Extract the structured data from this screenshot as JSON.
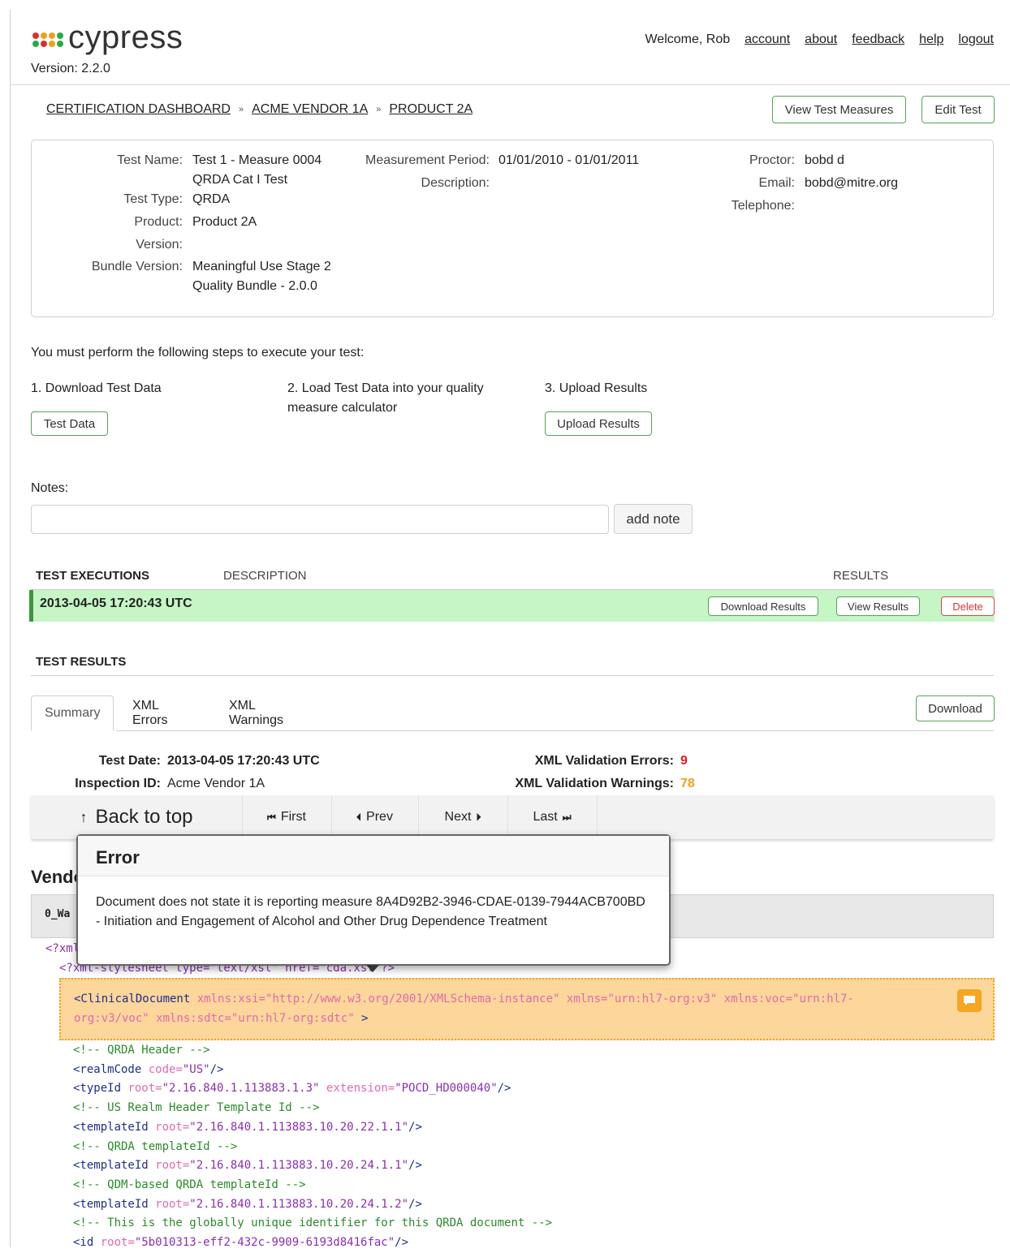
{
  "app": {
    "name": "cypress",
    "version": "Version: 2.2.0",
    "logo_colors": [
      "#d9312b",
      "#e8a31d",
      "#e8a31d",
      "#2ba84a",
      "#2ba84a",
      "#d9312b",
      "#e8a31d",
      "#2ba84a"
    ]
  },
  "topnav": {
    "welcome": "Welcome, Rob",
    "links": [
      "account",
      "about",
      "feedback",
      "help",
      "logout"
    ]
  },
  "breadcrumb": {
    "items": [
      "CERTIFICATION DASHBOARD",
      "ACME VENDOR 1A",
      "PRODUCT 2A"
    ],
    "separator": "»"
  },
  "actions": {
    "view_test_measures": "View Test Measures",
    "edit_test": "Edit Test"
  },
  "test_info": {
    "test_name_label": "Test Name:",
    "test_name": "Test 1 - Measure 0004\nQRDA Cat I Test",
    "test_type_label": "Test Type:",
    "test_type": "QRDA",
    "product_label": "Product:",
    "product": "Product 2A",
    "version_label": "Version:",
    "version": "",
    "bundle_version_label": "Bundle Version:",
    "bundle_version": "Meaningful Use Stage 2\nQuality Bundle - 2.0.0",
    "measurement_period_label": "Measurement Period:",
    "measurement_period": "01/01/2010 - 01/01/2011",
    "description_label": "Description:",
    "description": "",
    "proctor_label": "Proctor:",
    "proctor": "bobd d",
    "email_label": "Email:",
    "email": "bobd@mitre.org",
    "telephone_label": "Telephone:",
    "telephone": ""
  },
  "steps": {
    "intro": "You must perform the following steps to execute your test:",
    "step1": "1. Download Test Data",
    "step1_button": "Test Data",
    "step2": "2. Load Test Data into your quality measure calculator",
    "step3": "3. Upload Results",
    "step3_button": "Upload Results"
  },
  "notes": {
    "label": "Notes:",
    "value": "",
    "add_button": "add note"
  },
  "executions": {
    "col_executions": "TEST EXECUTIONS",
    "col_description": "DESCRIPTION",
    "col_results": "RESULTS",
    "rows": [
      {
        "date": "2013-04-05 17:20:43 UTC",
        "download": "Download Results",
        "view": "View Results",
        "delete": "Delete"
      }
    ]
  },
  "results": {
    "heading": "TEST RESULTS",
    "tabs": [
      "Summary",
      "XML Errors",
      "XML Warnings"
    ],
    "download": "Download",
    "test_date_label": "Test Date:",
    "test_date": "2013-04-05 17:20:43 UTC",
    "inspection_id_label": "Inspection ID:",
    "inspection_id": "Acme Vendor 1A",
    "errors_label": "XML Validation Errors:",
    "errors": "9",
    "warnings_label": "XML Validation Warnings:",
    "warnings": "78",
    "errors_color": "#e02020",
    "warnings_color": "#f0a020"
  },
  "nav_toolbar": {
    "back_to_top": "Back to top",
    "first": "First",
    "prev": "Prev",
    "next": "Next",
    "last": "Last"
  },
  "vendor": {
    "title": "Vendor",
    "file_name": "0_Wa"
  },
  "popover": {
    "title": "Error",
    "message": "Document does not state it is reporting measure 8A4D92B2-3946-CDAE-0139-7944ACB700BD - Initiation and Engagement of Alcohol and Other Drug Dependence Treatment"
  },
  "code": {
    "line_xml": "<?xml",
    "line_stylesheet": "<?xml-stylesheet type=\"text/xsl\" href=\"cda.xsl\"?>",
    "clinical_tag": "<ClinicalDocument",
    "clinical_attrs_1": " xmlns:xsi=\"http://www.w3.org/2001/XMLSchema-instance\" xmlns=\"urn:hl7-org:v3\" xmlns:voc=\"urn:hl7-",
    "clinical_attrs_2": "org:v3/voc\" xmlns:sdtc=\"urn:hl7-org:sdtc\"",
    "clinical_close": " >",
    "lines": [
      {
        "type": "comment",
        "text": "<!-- QRDA Header -->"
      },
      {
        "type": "element",
        "tag": "<realmCode",
        "attrs": [
          [
            "code",
            "\"US\""
          ]
        ],
        "close": "/>"
      },
      {
        "type": "element",
        "tag": "<typeId",
        "attrs": [
          [
            "root",
            "\"2.16.840.1.113883.1.3\""
          ],
          [
            "extension",
            "\"POCD_HD000040\""
          ]
        ],
        "close": "/>"
      },
      {
        "type": "comment",
        "text": "<!-- US Realm Header Template Id -->"
      },
      {
        "type": "element",
        "tag": "<templateId",
        "attrs": [
          [
            "root",
            "\"2.16.840.1.113883.10.20.22.1.1\""
          ]
        ],
        "close": "/>"
      },
      {
        "type": "comment",
        "text": "<!-- QRDA templateId -->"
      },
      {
        "type": "element",
        "tag": "<templateId",
        "attrs": [
          [
            "root",
            "\"2.16.840.1.113883.10.20.24.1.1\""
          ]
        ],
        "close": "/>"
      },
      {
        "type": "comment",
        "text": "<!-- QDM-based QRDA templateId -->"
      },
      {
        "type": "element",
        "tag": "<templateId",
        "attrs": [
          [
            "root",
            "\"2.16.840.1.113883.10.20.24.1.2\""
          ]
        ],
        "close": "/>"
      },
      {
        "type": "comment",
        "text": "<!-- This is the globally unique identifier for this QRDA document -->"
      },
      {
        "type": "element",
        "tag": "<id",
        "attrs": [
          [
            "root",
            "\"5b010313-eff2-432c-9909-6193d8416fac\""
          ]
        ],
        "close": "/>"
      }
    ]
  }
}
